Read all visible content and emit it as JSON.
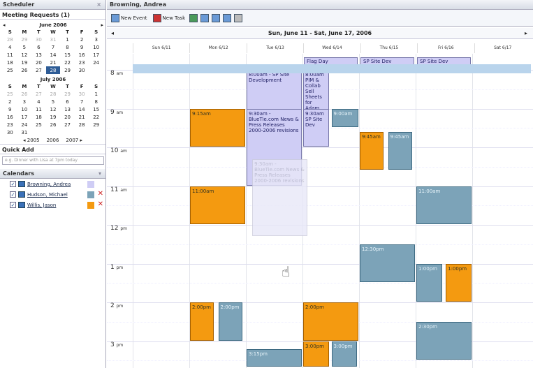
{
  "sidebar": {
    "title": "Scheduler",
    "close": "×",
    "meeting_requests": "Meeting Requests (1)",
    "cal1": {
      "prev": "◂",
      "next": "▸",
      "title": "June 2006",
      "days": [
        "S",
        "M",
        "T",
        "W",
        "T",
        "F",
        "S"
      ],
      "rows": [
        [
          "28",
          "29",
          "30",
          "31",
          "1",
          "2",
          "3"
        ],
        [
          "4",
          "5",
          "6",
          "7",
          "8",
          "9",
          "10"
        ],
        [
          "11",
          "12",
          "13",
          "14",
          "15",
          "16",
          "17"
        ],
        [
          "18",
          "19",
          "20",
          "21",
          "22",
          "23",
          "24"
        ],
        [
          "25",
          "26",
          "27",
          "28",
          "29",
          "30",
          ""
        ]
      ]
    },
    "cal2": {
      "title": "July 2006",
      "days": [
        "S",
        "M",
        "T",
        "W",
        "T",
        "F",
        "S"
      ],
      "rows": [
        [
          "25",
          "26",
          "27",
          "28",
          "29",
          "30",
          "1"
        ],
        [
          "2",
          "3",
          "4",
          "5",
          "6",
          "7",
          "8"
        ],
        [
          "9",
          "10",
          "11",
          "12",
          "13",
          "14",
          "15"
        ],
        [
          "16",
          "17",
          "18",
          "19",
          "20",
          "21",
          "22"
        ],
        [
          "23",
          "24",
          "25",
          "26",
          "27",
          "28",
          "29"
        ],
        [
          "30",
          "31",
          "",
          "",
          "",
          "",
          ""
        ]
      ]
    },
    "years": [
      "◂ 2005",
      "2006",
      "2007 ▸"
    ],
    "quick_add": "Quick Add",
    "quick_add_placeholder": "e.g. Dinner with Lisa at 7pm today",
    "calendars_title": "Calendars",
    "calendars": [
      {
        "name": "Browning, Andrea",
        "color": "#cfcdf5"
      },
      {
        "name": "Hudson, Michael",
        "color": "#7ca3b8"
      },
      {
        "name": "Willis, Jason",
        "color": "#f49a10"
      }
    ]
  },
  "main": {
    "title": "Browning, Andrea",
    "new_event": "New Event",
    "new_task": "New Task",
    "range": "Sun, June 11 - Sat, June 17, 2006",
    "day_headers": [
      "Sun 6/11",
      "Mon 6/12",
      "Tue 6/13",
      "Wed 6/14",
      "Thu 6/15",
      "Fri 6/16",
      "Sat 6/17"
    ],
    "hours": [
      {
        "h": "8",
        "ap": "am"
      },
      {
        "h": "9",
        "ap": "am"
      },
      {
        "h": "10",
        "ap": "am"
      },
      {
        "h": "11",
        "ap": "am"
      },
      {
        "h": "12",
        "ap": "pm"
      },
      {
        "h": "1",
        "ap": "pm"
      },
      {
        "h": "2",
        "ap": "pm"
      },
      {
        "h": "3",
        "ap": "pm"
      }
    ],
    "allday": [
      {
        "day": 3,
        "text": "Flag Day"
      },
      {
        "day": 4,
        "text": "SP Site Dev"
      },
      {
        "day": 5,
        "text": "SP Site Dev"
      }
    ],
    "events": [
      {
        "text": "8:00am - SP Site Development",
        "cls": "p"
      },
      {
        "text": "8:00am PIM & Collab Sell Sheets for Adam",
        "cls": "p"
      },
      {
        "text": "9:00am",
        "cls": "b"
      },
      {
        "text": "9:15am",
        "cls": "o"
      },
      {
        "text": "9:30am - BlueTie.com News & Press Releases 2000-2006 revisions",
        "cls": "p"
      },
      {
        "text": "9:30am SP Site Dev",
        "cls": "p"
      },
      {
        "text": "9:45am",
        "cls": "o"
      },
      {
        "text": "9:45am",
        "cls": "b"
      },
      {
        "text": "11:00am",
        "cls": "o"
      },
      {
        "text": "11:00am",
        "cls": "b"
      },
      {
        "text": "12:30pm",
        "cls": "b"
      },
      {
        "text": "1:00pm",
        "cls": "b"
      },
      {
        "text": "1:00pm",
        "cls": "o"
      },
      {
        "text": "2:00pm",
        "cls": "o"
      },
      {
        "text": "2:00pm",
        "cls": "b"
      },
      {
        "text": "2:00pm",
        "cls": "o"
      },
      {
        "text": "2:30pm",
        "cls": "b"
      },
      {
        "text": "3:00pm",
        "cls": "o"
      },
      {
        "text": "3:00pm",
        "cls": "b"
      },
      {
        "text": "3:15pm",
        "cls": "b"
      },
      {
        "text": "9:30am - BlueTie.com News & Press Releases 2000-2006 revisions",
        "cls": "g"
      }
    ]
  }
}
